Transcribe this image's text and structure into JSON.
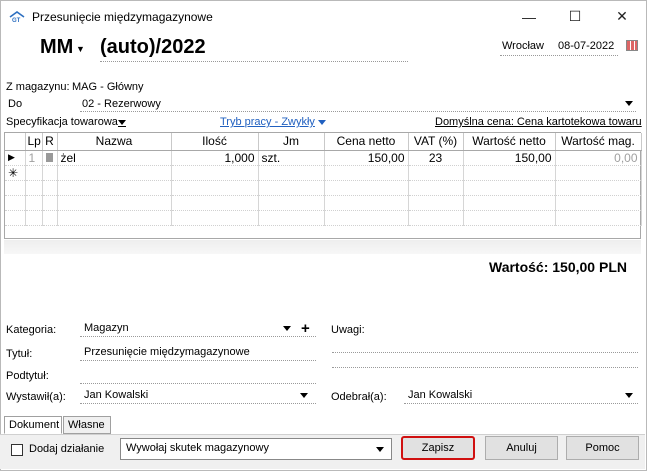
{
  "window": {
    "title": "Przesunięcie międzymagazynowe",
    "min_glyph": "—",
    "max_glyph": "☐",
    "close_glyph": "✕"
  },
  "header": {
    "doc_type": "MM",
    "doc_number": "(auto)/2022",
    "place": "Wrocław",
    "date": "08-07-2022"
  },
  "fields": {
    "from_label": "Z magazynu:",
    "from_value": "MAG - Główny",
    "to_label": "Do",
    "to_value": "02 - Rezerwowy",
    "spec_label": "Specyfikacja towarowa",
    "mode_label": "Tryb pracy - Zwykły",
    "default_price": "Domyślna cena: Cena kartotekowa towaru"
  },
  "grid": {
    "columns": [
      "Lp",
      "R",
      "Nazwa",
      "Ilość",
      "Jm",
      "Cena netto",
      "VAT (%)",
      "Wartość netto",
      "Wartość mag."
    ],
    "rows": [
      {
        "marker": "▶",
        "lp": "1",
        "r": "",
        "name": "żel",
        "qty": "1,000",
        "unit": "szt.",
        "price": "150,00",
        "vat": "23",
        "net": "150,00",
        "mag": "0,00"
      }
    ],
    "new_row_marker": "✳"
  },
  "total": "Wartość: 150,00 PLN",
  "bottom_form": {
    "category_label": "Kategoria:",
    "category_value": "Magazyn",
    "plus": "+",
    "notes_label": "Uwagi:",
    "title_label": "Tytuł:",
    "title_value": "Przesunięcie międzymagazynowe",
    "subtitle_label": "Podtytuł:",
    "issued_label": "Wystawił(a):",
    "issued_value": "Jan Kowalski",
    "received_label": "Odebrał(a):",
    "received_value": "Jan Kowalski"
  },
  "tabs": [
    "Dokument",
    "Własne"
  ],
  "footer": {
    "add_action_label": "Dodaj działanie",
    "action_combo": "Wywołaj skutek magazynowy",
    "save": "Zapisz",
    "cancel": "Anuluj",
    "help": "Pomoc"
  },
  "colors": {
    "link": "#2060c0",
    "highlight": "#d01010"
  },
  "icons": {
    "app": "app-icon",
    "calendar": "calendar-icon",
    "dropdown": "chevron-down-icon"
  }
}
